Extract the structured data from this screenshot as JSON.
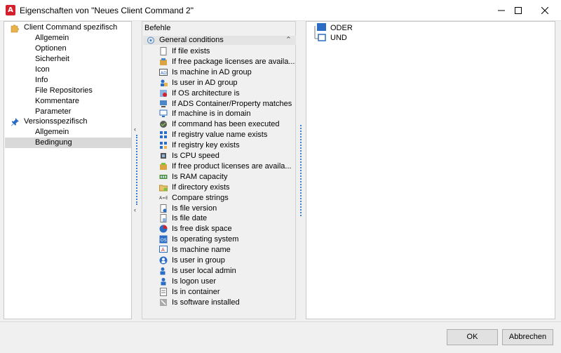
{
  "window": {
    "title": "Eigenschaften von \"Neues Client Command 2\"",
    "app_icon_letter": "A",
    "minimize_icon": "minimize-icon",
    "maximize_icon": "maximize-icon",
    "close_icon": "close-icon"
  },
  "tree": {
    "groups": [
      {
        "label": "Client Command spezifisch",
        "icon": "puzzle-icon",
        "items": [
          "Allgemein",
          "Optionen",
          "Sicherheit",
          "Icon",
          "Info",
          "File Repositories",
          "Kommentare",
          "Parameter"
        ]
      },
      {
        "label": "Versionsspezifisch",
        "icon": "pin-icon",
        "items": [
          "Allgemein",
          "Bedingung"
        ]
      }
    ],
    "selected": "Bedingung"
  },
  "commands": {
    "header": "Befehle",
    "group_label": "General conditions",
    "items": [
      "If file exists",
      "If free package licenses are availa...",
      "Is machine in AD group",
      "Is user in AD group",
      "If OS architecture is",
      "If ADS Container/Property matches",
      "If machine is in domain",
      "If command has been executed",
      "If registry value name exists",
      "If registry key exists",
      "Is CPU speed",
      "If free product licenses are availa...",
      "Is RAM capacity",
      "If directory exists",
      "Compare strings",
      "Is file version",
      "Is file date",
      "Is free disk space",
      "Is operating system",
      "Is machine name",
      "Is user in group",
      "Is user local admin",
      "Is logon user",
      "Is in container",
      "Is software installed"
    ]
  },
  "logic": {
    "items": [
      "ODER",
      "UND"
    ]
  },
  "buttons": {
    "ok": "OK",
    "cancel": "Abbrechen"
  },
  "colors": {
    "accent_blue": "#2b6cc4",
    "selection_gray": "#d9d9d9",
    "app_red": "#d4202c"
  }
}
